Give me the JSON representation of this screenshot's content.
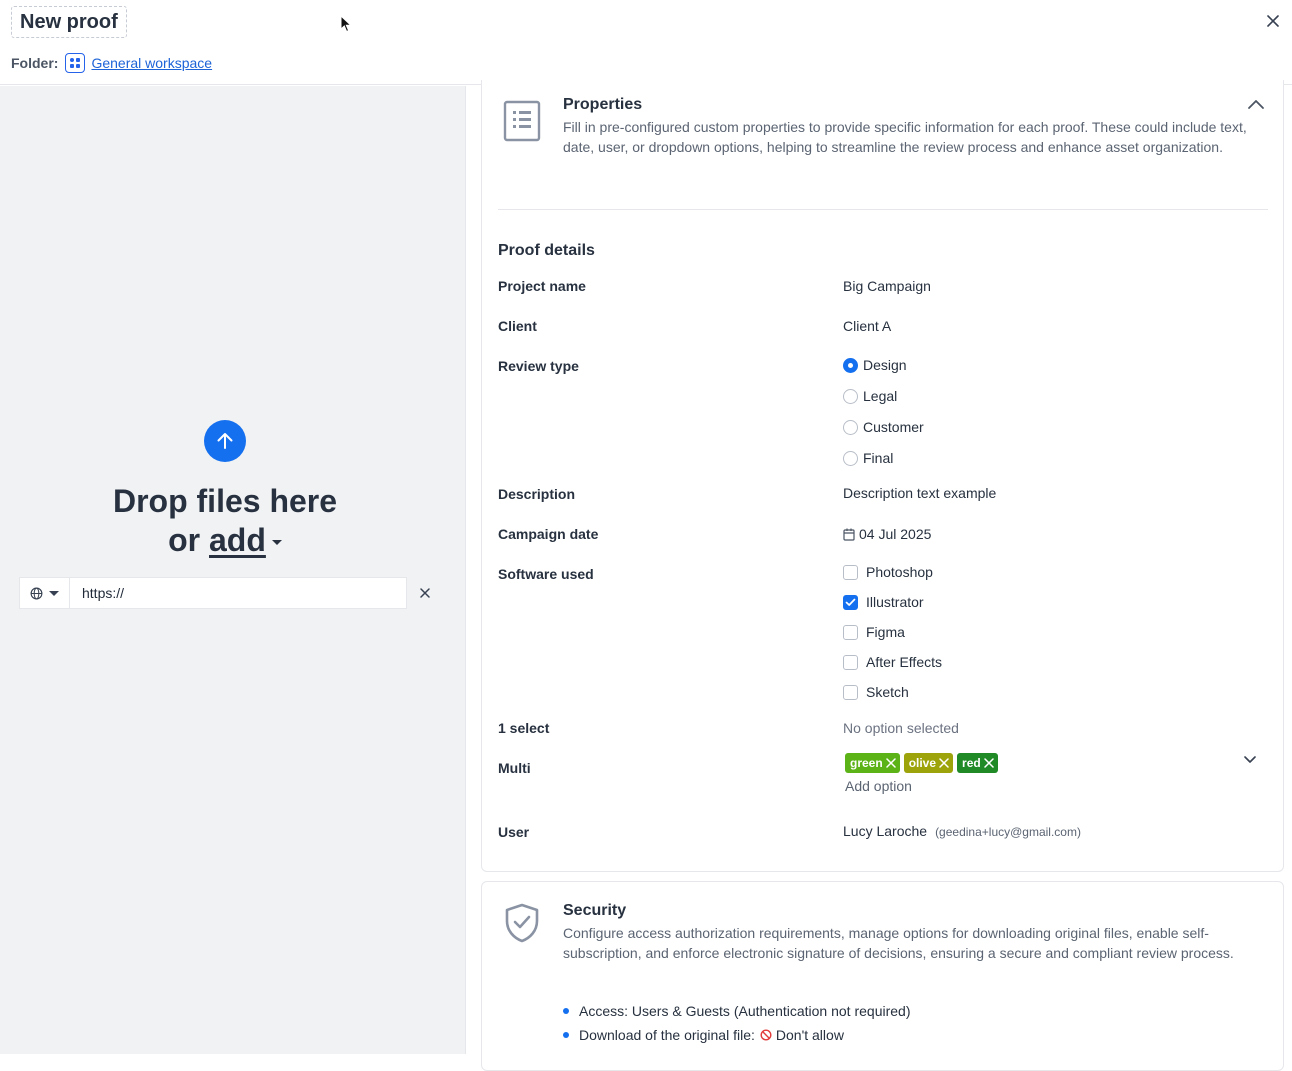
{
  "header": {
    "title": "New proof",
    "folder_label": "Folder:",
    "folder_name": "General workspace"
  },
  "upload": {
    "drop_line1": "Drop files here",
    "drop_or": "or",
    "drop_add": "add",
    "url_value": "https://"
  },
  "properties": {
    "title": "Properties",
    "description": "Fill in pre-configured custom properties to provide specific information for each proof. These could include text, date, user, or dropdown options, helping to streamline the review process and enhance asset organization.",
    "section_title": "Proof details",
    "project_name_label": "Project name",
    "project_name_value": "Big Campaign",
    "client_label": "Client",
    "client_value": "Client A",
    "review_type_label": "Review type",
    "review_types": [
      {
        "label": "Design",
        "selected": true
      },
      {
        "label": "Legal",
        "selected": false
      },
      {
        "label": "Customer",
        "selected": false
      },
      {
        "label": "Final",
        "selected": false
      }
    ],
    "description_label": "Description",
    "description_value": "Description text example",
    "campaign_date_label": "Campaign date",
    "campaign_date_value": "04 Jul 2025",
    "software_label": "Software used",
    "software": [
      {
        "label": "Photoshop",
        "checked": false
      },
      {
        "label": "Illustrator",
        "checked": true
      },
      {
        "label": "Figma",
        "checked": false
      },
      {
        "label": "After Effects",
        "checked": false
      },
      {
        "label": "Sketch",
        "checked": false
      }
    ],
    "select_label": "1 select",
    "select_value": "No option selected",
    "multi_label": "Multi",
    "multi_tags": [
      {
        "label": "green",
        "color": "#5cb318"
      },
      {
        "label": "olive",
        "color": "#9ca30b"
      },
      {
        "label": "red",
        "color": "#1f8a26"
      }
    ],
    "add_option": "Add option",
    "user_label": "User",
    "user_name": "Lucy Laroche",
    "user_email": "(geedina+lucy@gmail.com)"
  },
  "security": {
    "title": "Security",
    "description": "Configure access authorization requirements, manage options for downloading original files, enable self-subscription, and enforce electronic signature of decisions, ensuring a secure and compliant review process.",
    "access": "Access: Users & Guests (Authentication not required)",
    "download_label": "Download of the original file:",
    "download_value": "Don't allow"
  },
  "colors": {
    "accent": "#1570ef",
    "link": "#1d63d8"
  }
}
